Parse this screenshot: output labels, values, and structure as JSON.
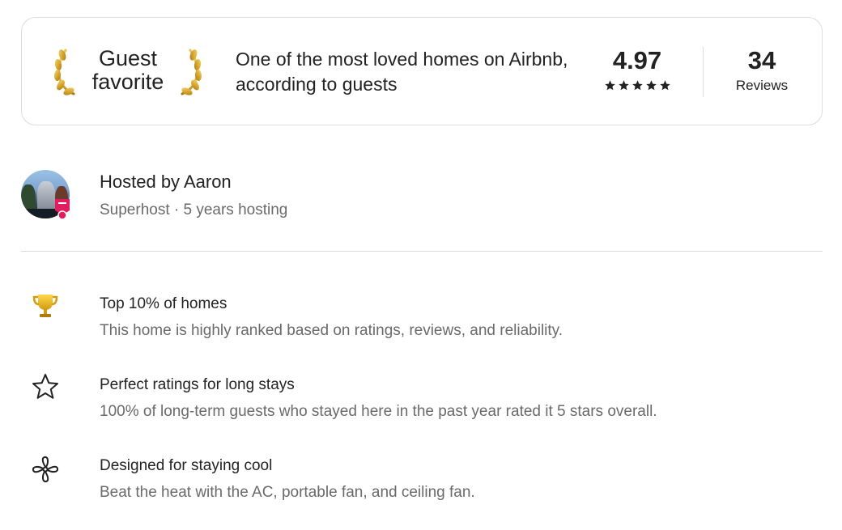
{
  "guest_favorite": {
    "title": "Guest favorite",
    "description": "One of the most loved homes on Airbnb, according to guests",
    "rating": "4.97",
    "stars": 5,
    "reviews_count": "34",
    "reviews_label": "Reviews"
  },
  "host": {
    "name": "Hosted by Aaron",
    "meta": "Superhost · 5 years hosting"
  },
  "highlights": [
    {
      "icon": "trophy-icon",
      "title": "Top 10% of homes",
      "description": "This home is highly ranked based on ratings, reviews, and reliability."
    },
    {
      "icon": "star-outline-icon",
      "title": "Perfect ratings for long stays",
      "description": "100% of long-term guests who stayed here in the past year rated it 5 stars overall."
    },
    {
      "icon": "fan-icon",
      "title": "Designed for staying cool",
      "description": "Beat the heat with the AC, portable fan, and ceiling fan."
    }
  ],
  "colors": {
    "text_primary": "#222222",
    "text_secondary": "#6a6a6a",
    "border": "#dddddd",
    "laurel_gold": "#d9a82e",
    "superhost_pink": "#e31c5f"
  }
}
